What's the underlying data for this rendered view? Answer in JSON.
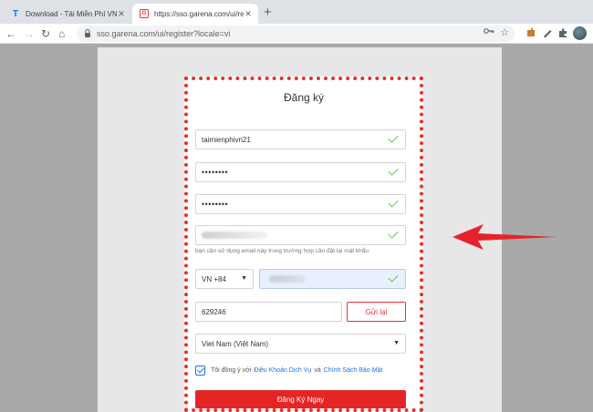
{
  "browser": {
    "tabs": [
      {
        "favicon": "T",
        "title": "Download - Tải Miễn Phí VN - Ph",
        "close": "✕"
      },
      {
        "favicon": "G",
        "title": "https://sso.garena.com/ui/registe",
        "close": "✕"
      }
    ],
    "new_tab": "+",
    "nav": {
      "back": "←",
      "forward": "→",
      "reload": "↻",
      "home": "⌂"
    },
    "url": "sso.garena.com/ui/register?locale=vi",
    "icons": [
      "lock-icon",
      "key-icon",
      "star-icon",
      "puzzle-icon",
      "pen-icon",
      "extensions-icon",
      "avatar"
    ]
  },
  "form": {
    "title": "Đăng ký",
    "username": "taimienphivn21",
    "password": "••••••••",
    "confirm_password": "••••••••",
    "email_hint": "bạn cần sử dụng email này trong trường hợp cần đặt lại mật khẩu",
    "country_code": "VN +84",
    "otp": "629246",
    "resend_label": "Gửi lại",
    "country": "Viet Nam (Việt Nam)",
    "agree_prefix": "Tôi đồng ý với",
    "terms_link": "Điều Khoản Dịch Vụ",
    "agree_and": "và",
    "privacy_link": "Chính Sách Bảo Mật",
    "submit_label": "Đăng Ký Ngay"
  },
  "colors": {
    "accent_red": "#e42525",
    "link_blue": "#1a73e8",
    "check_green": "#6cc04a"
  }
}
